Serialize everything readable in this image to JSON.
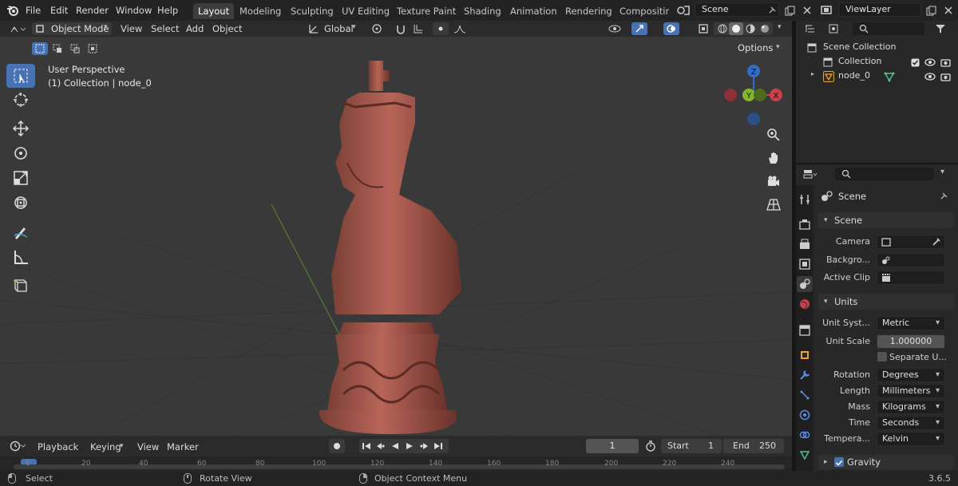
{
  "topbar": {
    "menus": [
      "File",
      "Edit",
      "Render",
      "Window",
      "Help"
    ],
    "workspaces": [
      "Layout",
      "Modeling",
      "Sculpting",
      "UV Editing",
      "Texture Paint",
      "Shading",
      "Animation",
      "Rendering",
      "Compositin"
    ],
    "scene_name": "Scene",
    "view_layer": "ViewLayer"
  },
  "viewport_header": {
    "mode": "Object Mode",
    "menus": [
      "View",
      "Select",
      "Add",
      "Object"
    ],
    "orientation": "Global",
    "options_label": "Options"
  },
  "viewport": {
    "perspective_label": "User Perspective",
    "collection_label": "(1) Collection | node_0",
    "gizmo": {
      "z": "Z",
      "y": "Y",
      "x": "X"
    }
  },
  "outliner": {
    "root": "Scene Collection",
    "items": [
      {
        "label": "Collection"
      },
      {
        "label": "node_0"
      }
    ]
  },
  "properties": {
    "header_title": "Scene",
    "scene_section": "Scene",
    "fields": {
      "camera_label": "Camera",
      "background_label": "Backgro...",
      "active_clip_label": "Active Clip"
    },
    "units_section": "Units",
    "unit_system_label": "Unit Syst...",
    "unit_system_value": "Metric",
    "unit_scale_label": "Unit Scale",
    "unit_scale_value": "1.000000",
    "separate_units_label": "Separate U...",
    "rotation_label": "Rotation",
    "rotation_value": "Degrees",
    "length_label": "Length",
    "length_value": "Millimeters",
    "mass_label": "Mass",
    "mass_value": "Kilograms",
    "time_label": "Time",
    "time_value": "Seconds",
    "temperature_label": "Tempera...",
    "temperature_value": "Kelvin",
    "gravity_label": "Gravity"
  },
  "timeline": {
    "menus": [
      "Playback",
      "Keying",
      "View",
      "Marker"
    ],
    "current_frame": "1",
    "start_label": "Start",
    "start_value": "1",
    "end_label": "End",
    "end_value": "250",
    "ticks": [
      "0",
      "20",
      "40",
      "60",
      "80",
      "100",
      "120",
      "140",
      "160",
      "180",
      "200",
      "220",
      "240"
    ]
  },
  "statusbar": {
    "select": "Select",
    "rotate": "Rotate View",
    "context": "Object Context Menu",
    "version": "3.6.5"
  }
}
